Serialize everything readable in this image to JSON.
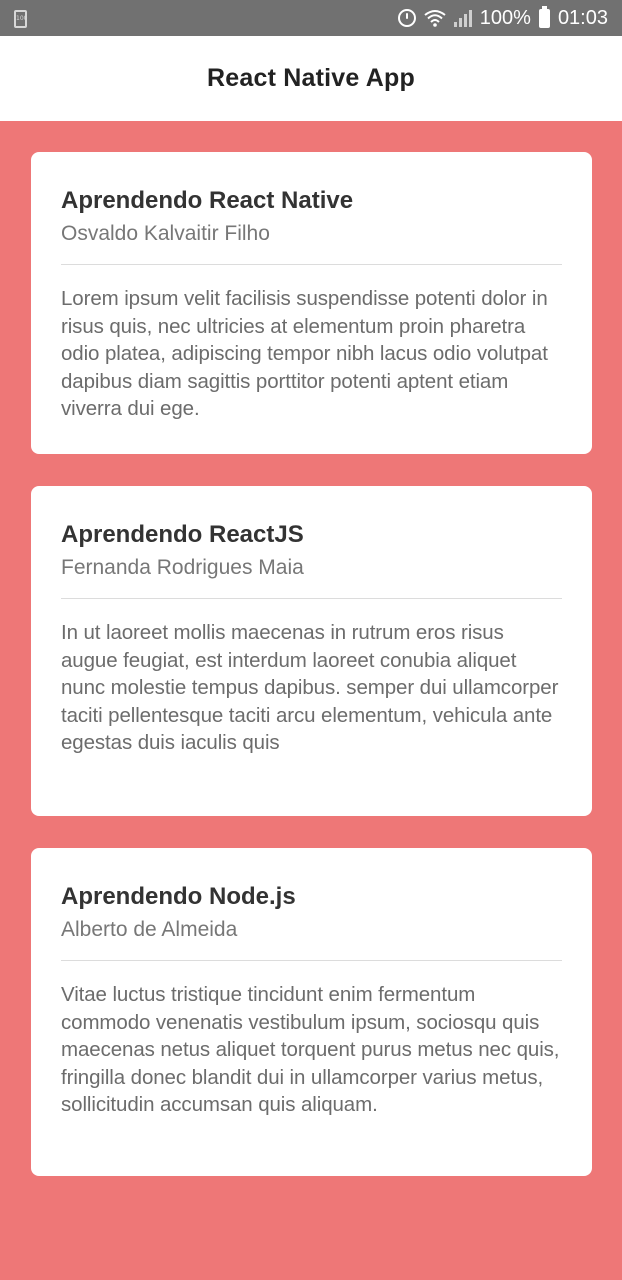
{
  "status_bar": {
    "battery_small_label": "100",
    "battery_percent": "100%",
    "time": "01:03",
    "icons": [
      "alarm-icon",
      "wifi-icon",
      "signal-icon",
      "battery-icon"
    ]
  },
  "header": {
    "title": "React Native App"
  },
  "colors": {
    "background": "#ee7777",
    "card": "#ffffff",
    "status_bar": "#717171"
  },
  "cards": [
    {
      "title": "Aprendendo React Native",
      "author": "Osvaldo Kalvaitir Filho",
      "body": "Lorem ipsum velit facilisis suspendisse potenti dolor in risus quis, nec ultricies at elementum proin pharetra odio platea, adipiscing tempor nibh lacus odio volutpat dapibus diam sagittis porttitor potenti aptent etiam viverra dui ege."
    },
    {
      "title": "Aprendendo ReactJS",
      "author": "Fernanda Rodrigues Maia",
      "body": "In ut laoreet mollis maecenas in rutrum eros risus augue feugiat, est interdum laoreet conubia aliquet nunc molestie tempus dapibus. semper dui ullamcorper taciti pellentesque taciti arcu elementum, vehicula ante egestas duis iaculis quis"
    },
    {
      "title": "Aprendendo Node.js",
      "author": "Alberto de Almeida",
      "body": "Vitae luctus tristique tincidunt enim fermentum commodo venenatis vestibulum ipsum, sociosqu quis maecenas netus aliquet torquent purus metus nec quis, fringilla donec blandit dui in ullamcorper varius metus,  sollicitudin accumsan quis aliquam."
    }
  ]
}
